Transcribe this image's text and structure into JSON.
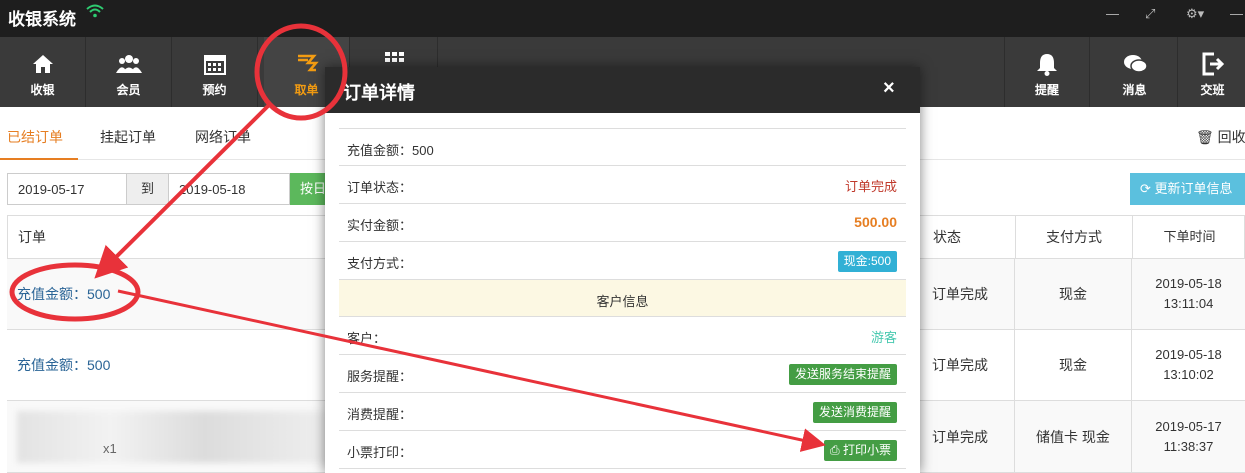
{
  "app": {
    "title": "收银系统"
  },
  "nav": [
    {
      "id": "cashier",
      "label": "收银"
    },
    {
      "id": "member",
      "label": "会员"
    },
    {
      "id": "booking",
      "label": "预约"
    },
    {
      "id": "takeorder",
      "label": "取单"
    },
    {
      "id": "remind",
      "label": "提醒"
    },
    {
      "id": "message",
      "label": "消息"
    },
    {
      "id": "handover",
      "label": "交班"
    }
  ],
  "subtabs": [
    "已结订单",
    "挂起订单",
    "网络订单"
  ],
  "recycle_label": "回收站",
  "filter": {
    "date_from": "2019-05-17",
    "to_label": "到",
    "date_to": "2019-05-18",
    "by_day_label": "按日",
    "refresh_label": "更新订单信息"
  },
  "table": {
    "headers": {
      "order": "订单",
      "status": "状态",
      "pay": "支付方式",
      "time": "下单时间"
    },
    "rows": [
      {
        "order": "充值金额：500",
        "status": "订单完成",
        "pay": "现金",
        "date": "2019-05-18",
        "clock": "13:11:04"
      },
      {
        "order": "充值金额：500",
        "status": "订单完成",
        "pay": "现金",
        "date": "2019-05-18",
        "clock": "13:10:02"
      },
      {
        "order_tail": "x1",
        "status": "订单完成",
        "pay": "储值卡 现金",
        "date": "2019-05-17",
        "clock": "11:38:37"
      }
    ]
  },
  "modal": {
    "title": "订单详情",
    "close": "×",
    "recharge": "充值金额：500",
    "status_label": "订单状态：",
    "status_value": "订单完成",
    "paid_label": "实付金额：",
    "paid_value": "500.00",
    "method_label": "支付方式：",
    "method_value": "现金:500",
    "section_title": "客户信息",
    "customer_label": "客户：",
    "customer_value": "游客",
    "service_label": "服务提醒：",
    "service_btn": "发送服务结束提醒",
    "consume_label": "消费提醒：",
    "consume_btn": "发送消费提醒",
    "receipt_label": "小票打印：",
    "receipt_btn": "打印小票"
  },
  "colors": {
    "accent": "#e67e22",
    "annotation": "#e8323a",
    "nav_bg": "#3a3a3a",
    "topbar_bg": "#1e1e1e"
  }
}
